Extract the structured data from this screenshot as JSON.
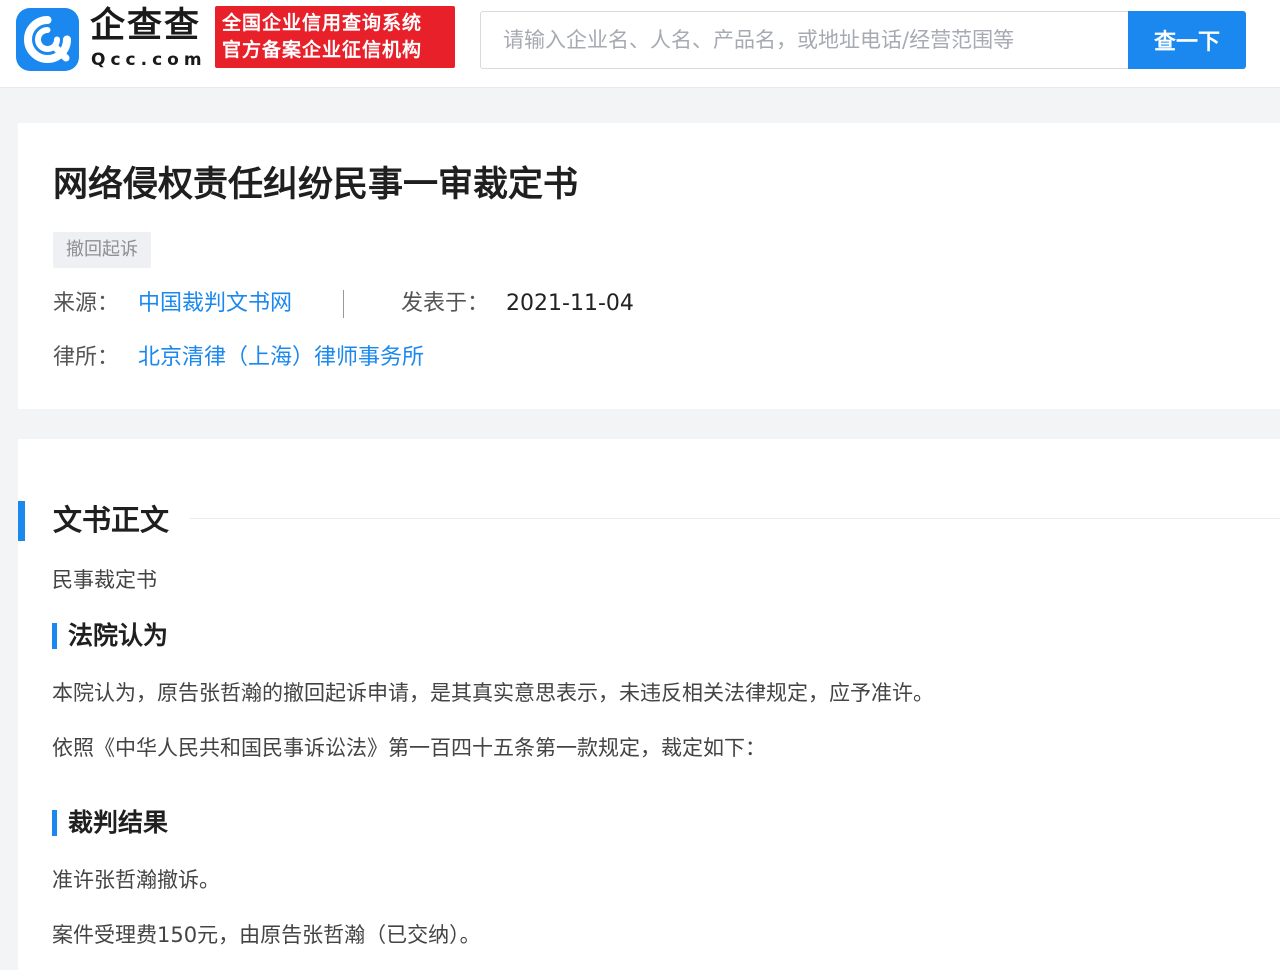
{
  "header": {
    "brand_cn": "企查查",
    "brand_en": "Qcc.com",
    "slogan_line1": "全国企业信用查询系统",
    "slogan_line2": "官方备案企业征信机构",
    "search_placeholder": "请输入企业名、人名、产品名，或地址电话/经营范围等",
    "search_button": "查一下",
    "accent_color": "#1a88ee",
    "slogan_color": "#e8202a"
  },
  "document": {
    "title": "网络侵权责任纠纷民事一审裁定书",
    "tag": "撤回起诉",
    "source_label": "来源：",
    "source_value": "中国裁判文书网",
    "published_label": "发表于：",
    "published_value": "2021-11-04",
    "firm_label": "律所：",
    "firm_value": "北京清律（上海）律师事务所"
  },
  "body": {
    "section_title": "文书正文",
    "doc_type": "民事裁定书",
    "court_opinion_title": "法院认为",
    "court_opinion_p1": "本院认为，原告张哲瀚的撤回起诉申请，是其真实意思表示，未违反相关法律规定，应予准许。",
    "court_opinion_p2": "依照《中华人民共和国民事诉讼法》第一百四十五条第一款规定，裁定如下：",
    "ruling_title": "裁判结果",
    "ruling_p1": "准许张哲瀚撤诉。",
    "ruling_p2": "案件受理费150元，由原告张哲瀚（已交纳）。"
  }
}
